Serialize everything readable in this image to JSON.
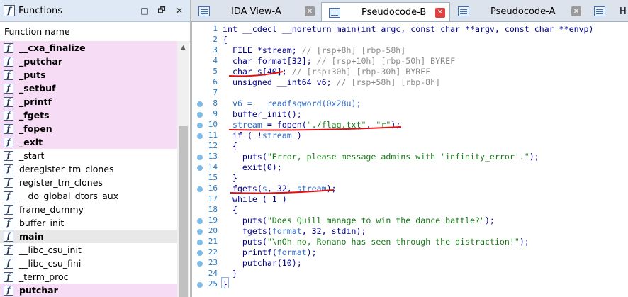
{
  "functions_panel": {
    "title": "Functions",
    "column_header": "Function name",
    "window_buttons": [
      "□",
      "🗗",
      "✕"
    ],
    "items": [
      {
        "name": "__cxa_finalize",
        "type": "lib"
      },
      {
        "name": "_putchar",
        "type": "lib"
      },
      {
        "name": "_puts",
        "type": "lib"
      },
      {
        "name": "_setbuf",
        "type": "lib"
      },
      {
        "name": "_printf",
        "type": "lib"
      },
      {
        "name": "_fgets",
        "type": "lib"
      },
      {
        "name": "_fopen",
        "type": "lib"
      },
      {
        "name": "_exit",
        "type": "lib"
      },
      {
        "name": "_start",
        "type": "normal"
      },
      {
        "name": "deregister_tm_clones",
        "type": "normal"
      },
      {
        "name": "register_tm_clones",
        "type": "normal"
      },
      {
        "name": "__do_global_dtors_aux",
        "type": "normal"
      },
      {
        "name": "frame_dummy",
        "type": "normal"
      },
      {
        "name": "buffer_init",
        "type": "normal"
      },
      {
        "name": "main",
        "type": "selected"
      },
      {
        "name": "__libc_csu_init",
        "type": "normal"
      },
      {
        "name": "__libc_csu_fini",
        "type": "normal"
      },
      {
        "name": "_term_proc",
        "type": "normal"
      },
      {
        "name": "putchar",
        "type": "lib"
      }
    ]
  },
  "tabs": [
    {
      "label": "IDA View-A",
      "active": false
    },
    {
      "label": "Pseudocode-B",
      "active": true
    },
    {
      "label": "Pseudocode-A",
      "active": false
    },
    {
      "label": "H",
      "active": false
    }
  ],
  "code": {
    "lines": [
      {
        "num": "1",
        "dot": false,
        "tokens": [
          [
            "int __cdecl __noreturn main(int argc, const char **argv, const char **envp)",
            "key"
          ]
        ]
      },
      {
        "num": "2",
        "dot": false,
        "tokens": [
          [
            "{",
            "key"
          ]
        ]
      },
      {
        "num": "3",
        "dot": false,
        "tokens": [
          [
            "  FILE *stream; ",
            "key"
          ],
          [
            "// [rsp+8h] [rbp-58h]",
            "cmt"
          ]
        ]
      },
      {
        "num": "4",
        "dot": false,
        "tokens": [
          [
            "  char format[32]; ",
            "key"
          ],
          [
            "// [rsp+10h] [rbp-50h] BYREF",
            "cmt"
          ]
        ]
      },
      {
        "num": "5",
        "dot": false,
        "tokens": [
          [
            "  char s[40]; ",
            "key"
          ],
          [
            "// [rsp+30h] [rbp-30h] BYREF",
            "cmt"
          ]
        ]
      },
      {
        "num": "6",
        "dot": false,
        "tokens": [
          [
            "  unsigned __int64 v6; ",
            "key"
          ],
          [
            "// [rsp+58h] [rbp-8h]",
            "cmt"
          ]
        ]
      },
      {
        "num": "7",
        "dot": false,
        "tokens": [
          [
            "",
            "key"
          ]
        ]
      },
      {
        "num": "8",
        "dot": true,
        "tokens": [
          [
            "  v6 = __readfsqword(0x28u);",
            "var"
          ]
        ]
      },
      {
        "num": "9",
        "dot": true,
        "tokens": [
          [
            "  buffer_init();",
            "key"
          ]
        ]
      },
      {
        "num": "10",
        "dot": true,
        "tokens": [
          [
            "  ",
            "key"
          ],
          [
            "stream",
            "var"
          ],
          [
            " = fopen(",
            "key"
          ],
          [
            "\"./flag.txt\"",
            "str"
          ],
          [
            ", ",
            "key"
          ],
          [
            "\"r\"",
            "str"
          ],
          [
            ");",
            "key"
          ]
        ]
      },
      {
        "num": "11",
        "dot": true,
        "tokens": [
          [
            "  if ( !",
            "key"
          ],
          [
            "stream",
            "var"
          ],
          [
            " )",
            "key"
          ]
        ]
      },
      {
        "num": "12",
        "dot": false,
        "tokens": [
          [
            "  {",
            "key"
          ]
        ]
      },
      {
        "num": "13",
        "dot": true,
        "tokens": [
          [
            "    puts(",
            "key"
          ],
          [
            "\"Error, please message admins with 'infinity_error'.\"",
            "str"
          ],
          [
            ");",
            "key"
          ]
        ]
      },
      {
        "num": "14",
        "dot": true,
        "tokens": [
          [
            "    exit(0);",
            "key"
          ]
        ]
      },
      {
        "num": "15",
        "dot": false,
        "tokens": [
          [
            "  }",
            "key"
          ]
        ]
      },
      {
        "num": "16",
        "dot": true,
        "tokens": [
          [
            "  fgets(",
            "key"
          ],
          [
            "s",
            "var"
          ],
          [
            ", 32, ",
            "key"
          ],
          [
            "stream",
            "var"
          ],
          [
            ");",
            "key"
          ]
        ]
      },
      {
        "num": "17",
        "dot": false,
        "tokens": [
          [
            "  while ( 1 )",
            "key"
          ]
        ]
      },
      {
        "num": "18",
        "dot": false,
        "tokens": [
          [
            "  {",
            "key"
          ]
        ]
      },
      {
        "num": "19",
        "dot": true,
        "tokens": [
          [
            "    puts(",
            "key"
          ],
          [
            "\"Does Quill manage to win the dance battle?\"",
            "str"
          ],
          [
            ");",
            "key"
          ]
        ]
      },
      {
        "num": "20",
        "dot": true,
        "tokens": [
          [
            "    fgets(",
            "key"
          ],
          [
            "format",
            "var"
          ],
          [
            ", 32, stdin);",
            "key"
          ]
        ]
      },
      {
        "num": "21",
        "dot": true,
        "tokens": [
          [
            "    puts(",
            "key"
          ],
          [
            "\"\\nOh no, Ronano has seen through the distraction!\"",
            "str"
          ],
          [
            ");",
            "key"
          ]
        ]
      },
      {
        "num": "22",
        "dot": true,
        "tokens": [
          [
            "    printf(",
            "key"
          ],
          [
            "format",
            "var"
          ],
          [
            ");",
            "key"
          ]
        ]
      },
      {
        "num": "23",
        "dot": true,
        "tokens": [
          [
            "    putchar(10);",
            "key"
          ]
        ]
      },
      {
        "num": "24",
        "dot": false,
        "tokens": [
          [
            "  }",
            "key"
          ]
        ]
      },
      {
        "num": "25",
        "dot": true,
        "tokens": [
          [
            "}",
            "key"
          ]
        ]
      }
    ]
  },
  "colors": {
    "library_highlight": "#f6dcf4",
    "annotation_red": "#e01010",
    "line_number_blue": "#2a7ac0",
    "breakpoint_dot": "#7fbde8"
  }
}
